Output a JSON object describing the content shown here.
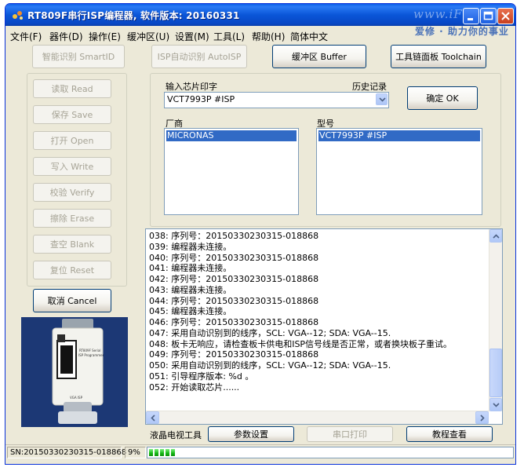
{
  "window": {
    "title": "RT809F串行ISP编程器, 软件版本: 20160331",
    "watermark_top": "www.iF",
    "watermark_right": "爱修 · 助力你的事业"
  },
  "menu": [
    "文件(F)",
    "器件(D)",
    "操作(E)",
    "缓冲区(U)",
    "设置(M)",
    "工具(L)",
    "帮助(H)",
    "简体中文"
  ],
  "toolbar": {
    "smart_id": "智能识别 SmartID",
    "auto_isp": "ISP自动识别 AutoISP",
    "buffer": "缓冲区 Buffer",
    "toolchain": "工具链面板 Toolchain"
  },
  "side_buttons": [
    {
      "label": "读取 Read",
      "name": "read-button"
    },
    {
      "label": "保存 Save",
      "name": "save-button"
    },
    {
      "label": "打开 Open",
      "name": "open-button"
    },
    {
      "label": "写入 Write",
      "name": "write-button"
    },
    {
      "label": "校验 Verify",
      "name": "verify-button"
    },
    {
      "label": "擦除 Erase",
      "name": "erase-button"
    },
    {
      "label": "查空 Blank",
      "name": "blank-button"
    },
    {
      "label": "复位 Reset",
      "name": "reset-button"
    }
  ],
  "cancel_label": "取消 Cancel",
  "chip": {
    "input_label": "输入芯片印字",
    "history_label": "历史记录",
    "value": "VCT7993P #ISP",
    "ok_label": "确定 OK",
    "vendor_label": "厂商",
    "model_label": "型号",
    "vendor_selected": "MICRONAS",
    "model_selected": "VCT7993P #ISP"
  },
  "log": [
    "038: 序列号：20150330230315-018868",
    "039: 编程器未连接。",
    "040: 序列号：20150330230315-018868",
    "041: 编程器未连接。",
    "042: 序列号：20150330230315-018868",
    "043: 编程器未连接。",
    "044: 序列号：20150330230315-018868",
    "045: 编程器未连接。",
    "046: 序列号：20150330230315-018868",
    "047: 采用自动识别到的线序，SCL: VGA--12; SDA: VGA--15.",
    "048: 板卡无响应，请检查板卡供电和ISP信号线是否正常，或者换块板子重试。",
    "049: 序列号：20150330230315-018868",
    "050: 采用自动识别到的线序，SCL: VGA--12; SDA: VGA--15.",
    "051: 引导程序版本: %d 。",
    "052: 开始读取芯片......"
  ],
  "bottom": {
    "lcd_label": "液晶电视工具",
    "params": "参数设置",
    "serial_print": "串口打印",
    "tutorial": "教程查看"
  },
  "photo_caption": {
    "line1": "RT809F Serial",
    "line2": "ISP Programmer",
    "port_label": "VGA ISP"
  },
  "status": {
    "serial": "SN:20150330230315-018868",
    "percent": "9%",
    "progress_fraction": 0.09
  }
}
